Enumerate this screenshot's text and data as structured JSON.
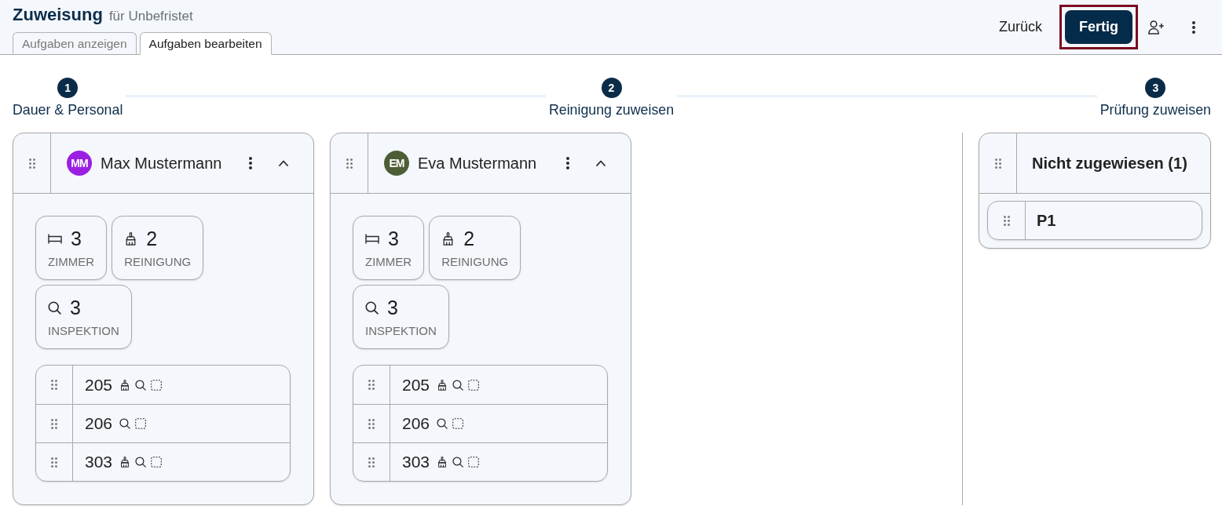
{
  "header": {
    "title": "Zuweisung",
    "subtitle": "für Unbefristet",
    "tabs": [
      {
        "label": "Aufgaben anzeigen",
        "selected": false
      },
      {
        "label": "Aufgaben bearbeiten",
        "selected": true
      }
    ],
    "back_button": "Zurück",
    "done_button": {
      "label": "Fertig",
      "focused": true
    }
  },
  "steps": [
    {
      "number": "1",
      "label": "Dauer & Personal"
    },
    {
      "number": "2",
      "label": "Reinigung zuweisen"
    },
    {
      "number": "3",
      "label": "Prüfung zuweisen"
    }
  ],
  "staff": [
    {
      "initials": "MM",
      "name": "Max Mustermann",
      "color": "#9b1fe3",
      "expanded": true,
      "stats": [
        {
          "kind": "rooms",
          "value": "3",
          "label": "ZIMMER"
        },
        {
          "kind": "cleaning",
          "value": "2",
          "label": "REINIGUNG"
        },
        {
          "kind": "inspection",
          "value": "3",
          "label": "INSPEKTION"
        }
      ],
      "rooms": [
        {
          "number": "205",
          "cleaning": true,
          "inspection": true
        },
        {
          "number": "206",
          "cleaning": false,
          "inspection": true
        },
        {
          "number": "303",
          "cleaning": true,
          "inspection": true
        }
      ]
    },
    {
      "initials": "EM",
      "name": "Eva Mustermann",
      "color": "#4d5e37",
      "expanded": true,
      "stats": [
        {
          "kind": "rooms",
          "value": "3",
          "label": "ZIMMER"
        },
        {
          "kind": "cleaning",
          "value": "2",
          "label": "REINIGUNG"
        },
        {
          "kind": "inspection",
          "value": "3",
          "label": "INSPEKTION"
        }
      ],
      "rooms": [
        {
          "number": "205",
          "cleaning": true,
          "inspection": true
        },
        {
          "number": "206",
          "cleaning": false,
          "inspection": true
        },
        {
          "number": "303",
          "cleaning": true,
          "inspection": true
        }
      ]
    }
  ],
  "unassigned": {
    "title": "Nicht zugewiesen (1)",
    "items": [
      {
        "label": "P1"
      }
    ]
  }
}
